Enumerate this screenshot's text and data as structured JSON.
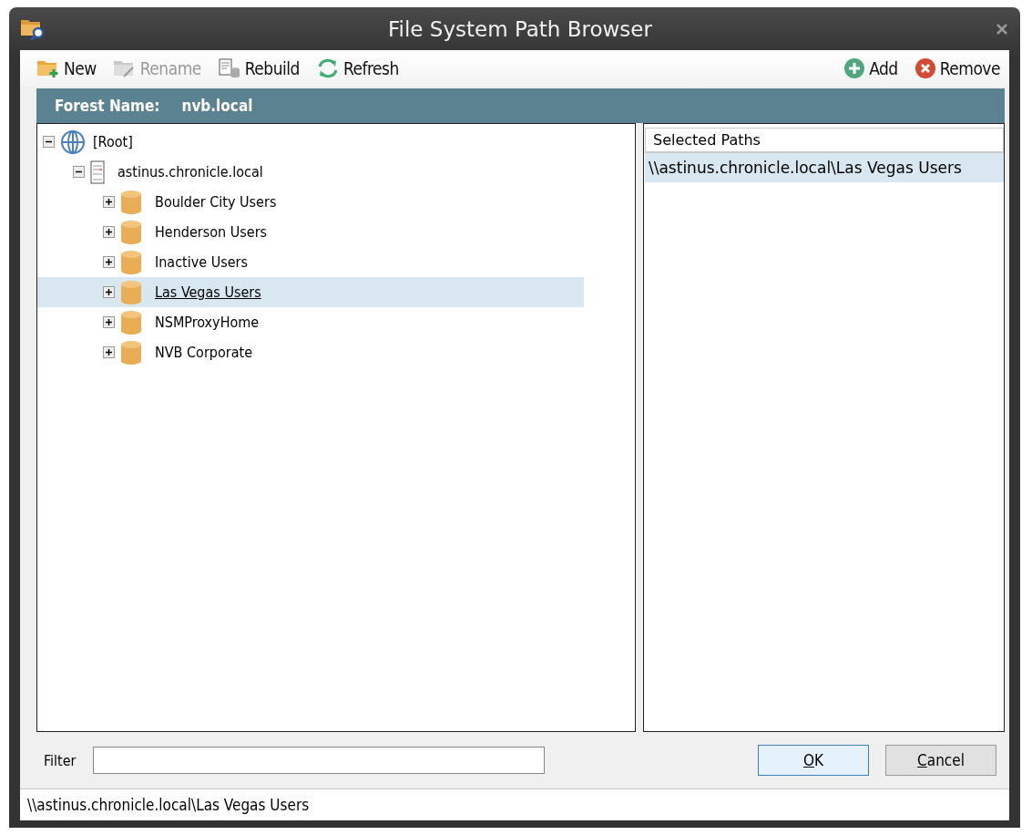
{
  "window": {
    "title": "File System Path Browser"
  },
  "toolbar": {
    "left": [
      {
        "kind": "new",
        "label": "New",
        "disabled": false
      },
      {
        "kind": "rename",
        "label": "Rename",
        "disabled": true
      },
      {
        "kind": "rebuild",
        "label": "Rebuild",
        "disabled": false
      },
      {
        "kind": "refresh",
        "label": "Refresh",
        "disabled": false
      }
    ],
    "right": [
      {
        "kind": "add",
        "label": "Add",
        "disabled": false
      },
      {
        "kind": "remove",
        "label": "Remove",
        "disabled": false
      }
    ]
  },
  "forest": {
    "label": "Forest Name:",
    "value": "nvb.local"
  },
  "tree": [
    {
      "kind": "root",
      "label": "[Root]",
      "expanded": true,
      "selected": false,
      "children": [
        {
          "kind": "server",
          "label": "astinus.chronicle.local",
          "expanded": true,
          "selected": false,
          "children": [
            {
              "kind": "share",
              "label": "Boulder City Users",
              "expanded": false,
              "selected": false
            },
            {
              "kind": "share",
              "label": "Henderson Users",
              "expanded": false,
              "selected": false
            },
            {
              "kind": "share",
              "label": "Inactive Users",
              "expanded": false,
              "selected": false
            },
            {
              "kind": "share",
              "label": "Las Vegas Users",
              "expanded": false,
              "selected": true
            },
            {
              "kind": "share",
              "label": "NSMProxyHome",
              "expanded": false,
              "selected": false
            },
            {
              "kind": "share",
              "label": "NVB Corporate",
              "expanded": false,
              "selected": false
            }
          ]
        }
      ]
    }
  ],
  "selected_paths": {
    "column": "Selected Paths",
    "rows": [
      {
        "path": "\\\\astinus.chronicle.local\\Las Vegas Users",
        "selected": true
      }
    ]
  },
  "filter": {
    "label": "Filter"
  },
  "buttons": [
    {
      "label": "OK",
      "default": true,
      "mnemonic_underlined": true
    },
    {
      "label": "Cancel",
      "default": false,
      "mnemonic_underlined": true
    }
  ],
  "status_bar": "\\\\astinus.chronicle.local\\Las Vegas Users"
}
